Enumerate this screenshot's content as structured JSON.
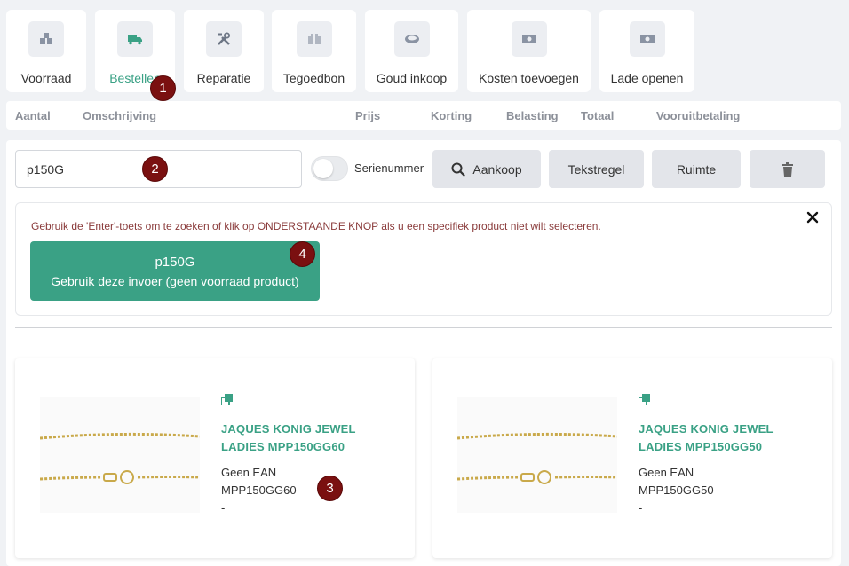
{
  "toolbar": [
    {
      "label": "Voorraad",
      "icon": "boxes-icon",
      "active": false
    },
    {
      "label": "Bestellen",
      "icon": "truck-icon",
      "active": true
    },
    {
      "label": "Reparatie",
      "icon": "tools-icon",
      "active": false
    },
    {
      "label": "Tegoedbon",
      "icon": "voucher-icon",
      "active": false
    },
    {
      "label": "Goud inkoop",
      "icon": "gold-ring-icon",
      "active": false
    },
    {
      "label": "Kosten toevoegen",
      "icon": "banknote-icon",
      "active": false
    },
    {
      "label": "Lade openen",
      "icon": "banknote-icon",
      "active": false
    }
  ],
  "columns": [
    "Aantal",
    "Omschrijving",
    "Prijs",
    "Korting",
    "Belasting",
    "Totaal",
    "Vooruitbetaling"
  ],
  "search": {
    "value": "p150G"
  },
  "serial_toggle": {
    "label": "Serienummer",
    "on": false
  },
  "buttons": {
    "aankoop": "Aankoop",
    "tekstregel": "Tekstregel",
    "ruimte": "Ruimte"
  },
  "alert": {
    "message": "Gebruik de 'Enter'-toets om te zoeken of klik op ONDERSTAANDE KNOP als u een specifiek product niet wilt selecteren.",
    "use_input_value": "p150G",
    "use_input_label": "Gebruik deze invoer (geen voorraad product)"
  },
  "products": [
    {
      "name": "JAQUES KONIG JEWEL LADIES MPP150GG60",
      "ean": "Geen EAN",
      "code": "MPP150GG60",
      "extra": "-"
    },
    {
      "name": "JAQUES KONIG JEWEL LADIES MPP150GG50",
      "ean": "Geen EAN",
      "code": "MPP150GG50",
      "extra": "-"
    }
  ],
  "badges": [
    "1",
    "2",
    "3",
    "4"
  ],
  "colors": {
    "accent": "#3aa185",
    "badge": "#7a1010",
    "alert_text": "#8a3b3b"
  }
}
